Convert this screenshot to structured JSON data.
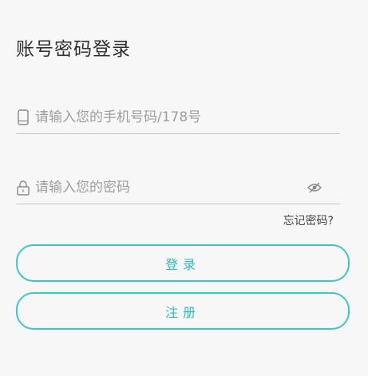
{
  "page": {
    "title": "账号密码登录"
  },
  "form": {
    "phone": {
      "placeholder": "请输入您的手机号码/178号",
      "value": "",
      "icon": "phone-icon"
    },
    "password": {
      "placeholder": "请输入您的密码",
      "value": "",
      "icon": "lock-icon",
      "toggle_icon": "eye-hidden-icon"
    },
    "forgot_label": "忘记密码?"
  },
  "actions": {
    "login_label": "登录",
    "register_label": "注册"
  },
  "colors": {
    "accent": "#3cc7c4",
    "background": "#f7f7f7",
    "divider": "#c9c9c9"
  }
}
